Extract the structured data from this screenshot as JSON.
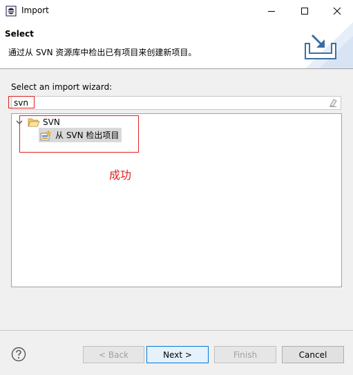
{
  "window": {
    "title": "Import"
  },
  "header": {
    "title": "Select",
    "description": "通过从 SVN 资源库中检出已有项目来创建新项目。"
  },
  "wizard": {
    "label": "Select an import wizard:",
    "filter_value": "svn"
  },
  "tree": {
    "category": "SVN",
    "child": "从 SVN 检出项目",
    "expanded": true
  },
  "annotation": {
    "text": "成功",
    "color": "#e02020"
  },
  "buttons": {
    "back": "< Back",
    "next": "Next >",
    "finish": "Finish",
    "cancel": "Cancel"
  },
  "colors": {
    "accent": "#0078d7",
    "selection": "#d9d9d9"
  }
}
